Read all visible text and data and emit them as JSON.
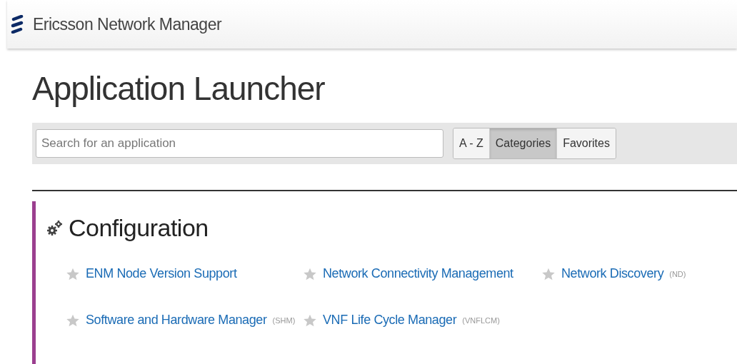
{
  "header": {
    "title": "Ericsson Network Manager"
  },
  "page_title": "Application Launcher",
  "search": {
    "placeholder": "Search for an application"
  },
  "view_tabs": [
    {
      "label": "A - Z",
      "selected": false
    },
    {
      "label": "Categories",
      "selected": true
    },
    {
      "label": "Favorites",
      "selected": false
    }
  ],
  "category": {
    "title": "Configuration",
    "apps": [
      {
        "name": "ENM Node Version Support",
        "favorite": false
      },
      {
        "name": "Network Connectivity Management",
        "favorite": false
      },
      {
        "name": "Network Discovery",
        "abbreviation": "(ND)",
        "favorite": false
      },
      {
        "name": "Software and Hardware Manager",
        "abbreviation": "(SHM)",
        "favorite": false
      },
      {
        "name": "VNF Life Cycle Manager",
        "abbreviation": "(VNFLCM)",
        "favorite": false
      }
    ]
  }
}
